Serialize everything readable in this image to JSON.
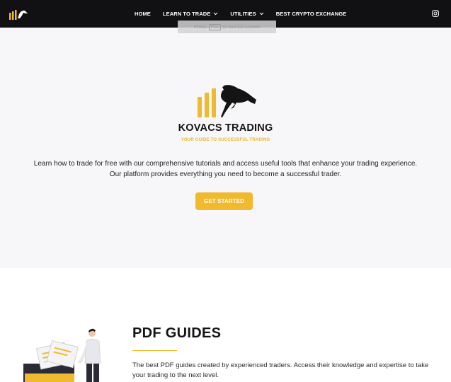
{
  "nav": {
    "items": [
      {
        "label": "HOME",
        "has_dropdown": false
      },
      {
        "label": "LEARN TO TRADE",
        "has_dropdown": true
      },
      {
        "label": "UTILITIES",
        "has_dropdown": true
      },
      {
        "label": "BEST CRYPTO EXCHANGE",
        "has_dropdown": false
      }
    ],
    "right_icon": "instagram-icon"
  },
  "fullscreen_hint": {
    "prefix": "Press",
    "key": "F11",
    "suffix": "to exit full screen"
  },
  "hero": {
    "brand": "KOVACS TRADING",
    "tagline": "YOUR GUIDE TO SUCCESSFUL TRADING",
    "text_line1": "Learn how to trade for free with our comprehensive tutorials and access useful tools that enhance your trading experience.",
    "text_line2": "Our platform provides everything you need to become a successful trader.",
    "cta": "GET STARTED"
  },
  "pdf_section": {
    "title": "PDF GUIDES",
    "text": "The best PDF guides created by experienced traders. Access their knowledge and expertise to take your trading to the next level."
  },
  "colors": {
    "accent": "#f1b92e",
    "nav_bg": "#111113",
    "hero_bg": "#f7f7f9"
  }
}
